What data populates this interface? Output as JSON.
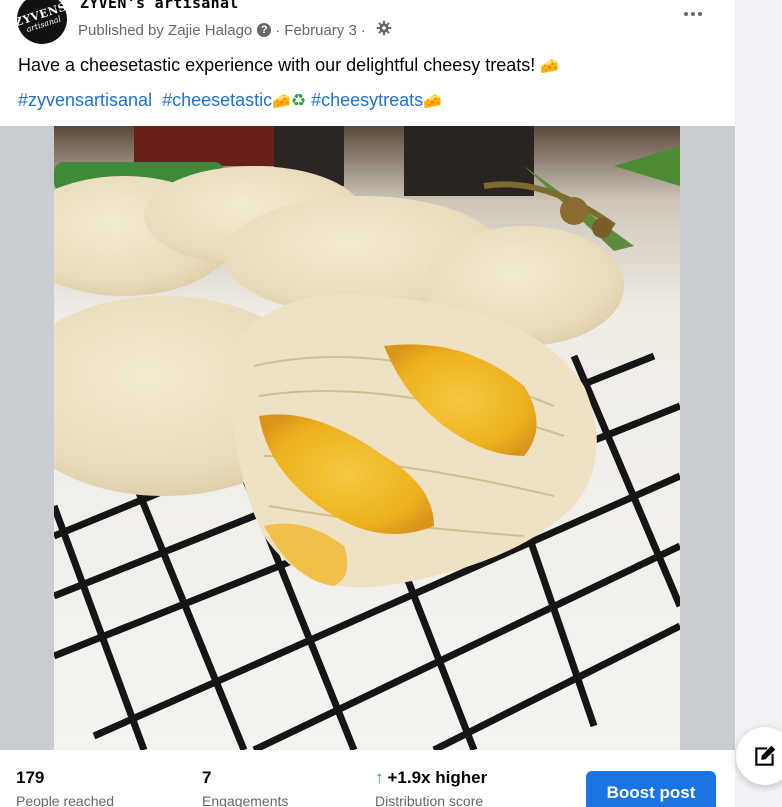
{
  "post": {
    "page_name": "ZYVEN's artisanal",
    "avatar_text_top": "ZYVENS",
    "avatar_text_bottom": "artisanal",
    "published_by": "Published by Zajie Halago",
    "separator": "·",
    "date": "February 3",
    "text": "Have a cheesetastic experience with our delightful cheesy treats!",
    "text_emoji": "🧀",
    "hashtags": [
      {
        "label": "#zyvensartisanal",
        "emoji": ""
      },
      {
        "label": "#cheesetastic",
        "emoji": "🧀"
      },
      {
        "label": "#cheesytreats",
        "emoji": "🧀"
      }
    ],
    "recycle_emoji": "♻"
  },
  "image": {
    "description_icon": "photo-of-cheese-pastries"
  },
  "insights": {
    "reach_value": "179",
    "reach_label": "People reached",
    "engagement_value": "7",
    "engagement_label": "Engagements",
    "distribution_value": "+1.9x higher",
    "distribution_label": "Distribution score",
    "boost_label": "Boost post"
  },
  "colors": {
    "accent": "#1b74e4",
    "link": "#216fdb",
    "muted": "#65676b",
    "positive": "#2e9e43"
  }
}
